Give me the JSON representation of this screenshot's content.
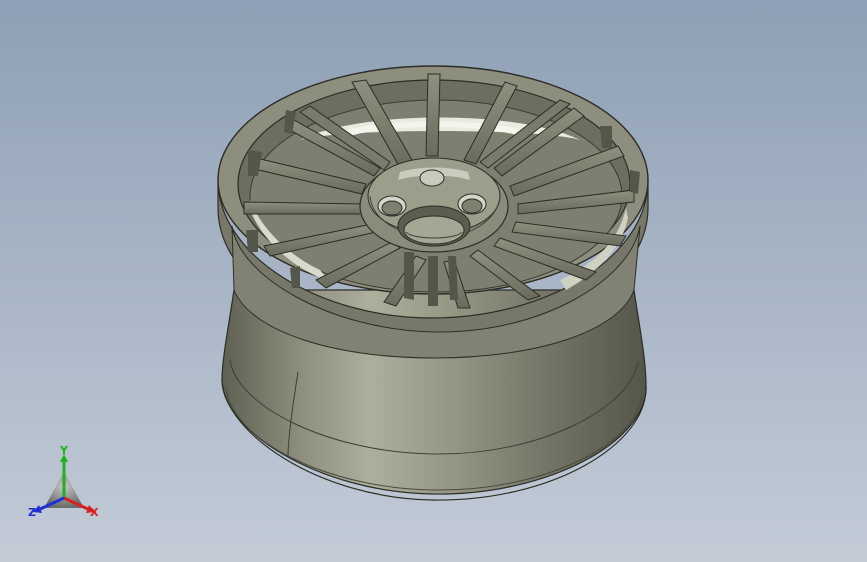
{
  "viewport": {
    "background_top": "#8ea0b5",
    "background_bottom": "#c3cbd7",
    "model": {
      "name": "alloy wheel rim",
      "spoke_count": 18,
      "lug_holes_visible": 3,
      "color": "#7b7c6c"
    },
    "triad": {
      "x_label": "X",
      "y_label": "Y",
      "z_label": "Z",
      "x_color": "#d42020",
      "y_color": "#20b020",
      "z_color": "#2030d0"
    }
  }
}
